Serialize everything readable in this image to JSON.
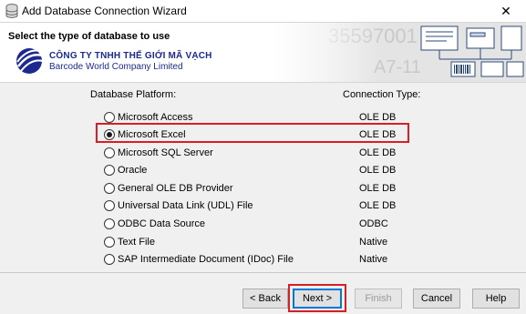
{
  "window": {
    "title": "Add Database Connection Wizard",
    "close_label": "✕"
  },
  "header": {
    "heading": "Select the type of database to use",
    "company_name": "CÔNG TY TNHH THẾ GIỚI MÃ VẠCH",
    "company_subtitle": "Barcode World Company Limited",
    "banner_text_1": "35597001",
    "banner_text_2": "A7-11"
  },
  "columns": {
    "platform": "Database Platform:",
    "connection": "Connection Type:"
  },
  "platforms": [
    {
      "label": "Microsoft Access",
      "type": "OLE DB",
      "checked": false
    },
    {
      "label": "Microsoft Excel",
      "type": "OLE DB",
      "checked": true
    },
    {
      "label": "Microsoft SQL Server",
      "type": "OLE DB",
      "checked": false
    },
    {
      "label": "Oracle",
      "type": "OLE DB",
      "checked": false
    },
    {
      "label": "General OLE DB Provider",
      "type": "OLE DB",
      "checked": false
    },
    {
      "label": "Universal Data Link (UDL) File",
      "type": "OLE DB",
      "checked": false
    },
    {
      "label": "ODBC Data Source",
      "type": "ODBC",
      "checked": false
    },
    {
      "label": "Text File",
      "type": "Native",
      "checked": false
    },
    {
      "label": "SAP Intermediate Document (IDoc) File",
      "type": "Native",
      "checked": false
    }
  ],
  "buttons": {
    "back": "< Back",
    "next": "Next >",
    "finish": "Finish",
    "cancel": "Cancel",
    "help": "Help"
  },
  "colors": {
    "highlight": "#d81f26",
    "focus": "#0078d7",
    "brand": "#1c2a8f"
  }
}
